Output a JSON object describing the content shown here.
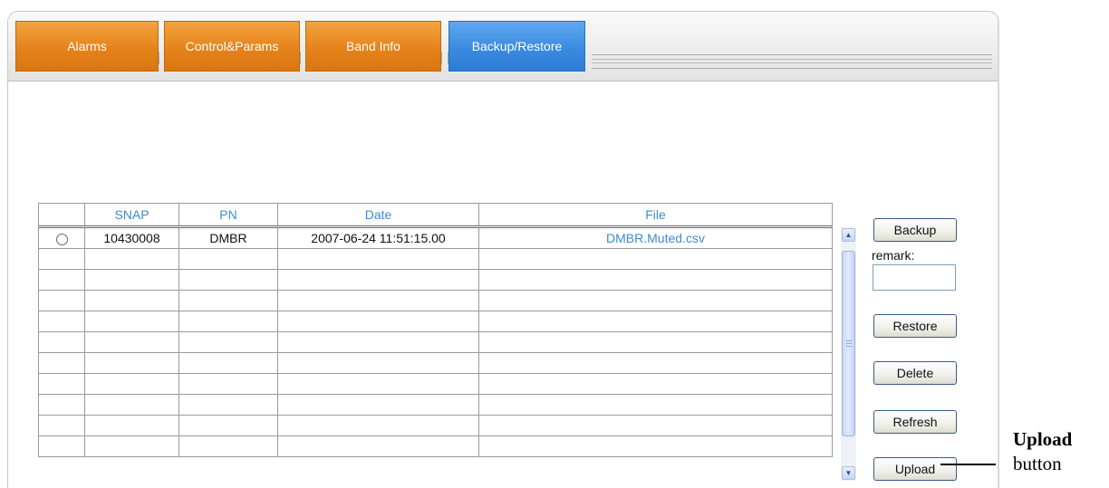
{
  "tabs": [
    {
      "label": "Alarms",
      "active": false
    },
    {
      "label": "Control&Params",
      "active": false
    },
    {
      "label": "Band Info",
      "active": false
    },
    {
      "label": "Backup/Restore",
      "active": true
    }
  ],
  "table": {
    "columns": [
      "",
      "SNAP",
      "PN",
      "Date",
      "File"
    ],
    "rows": [
      {
        "selected": false,
        "snap": "10430008",
        "pn": "DMBR",
        "date": "2007-06-24 11:51:15.00",
        "file": "DMBR.Muted.csv"
      }
    ],
    "empty_rows": 10
  },
  "actions": {
    "backup": "Backup",
    "remark_label": "remark:",
    "remark_value": "",
    "restore": "Restore",
    "delete": "Delete",
    "refresh": "Refresh",
    "upload": "Upload"
  },
  "annotation": {
    "title": "Upload",
    "subtitle": "button"
  },
  "colors": {
    "tab_inactive": "#e5831b",
    "tab_active": "#3a8be0",
    "header_text": "#3d8bd4"
  }
}
